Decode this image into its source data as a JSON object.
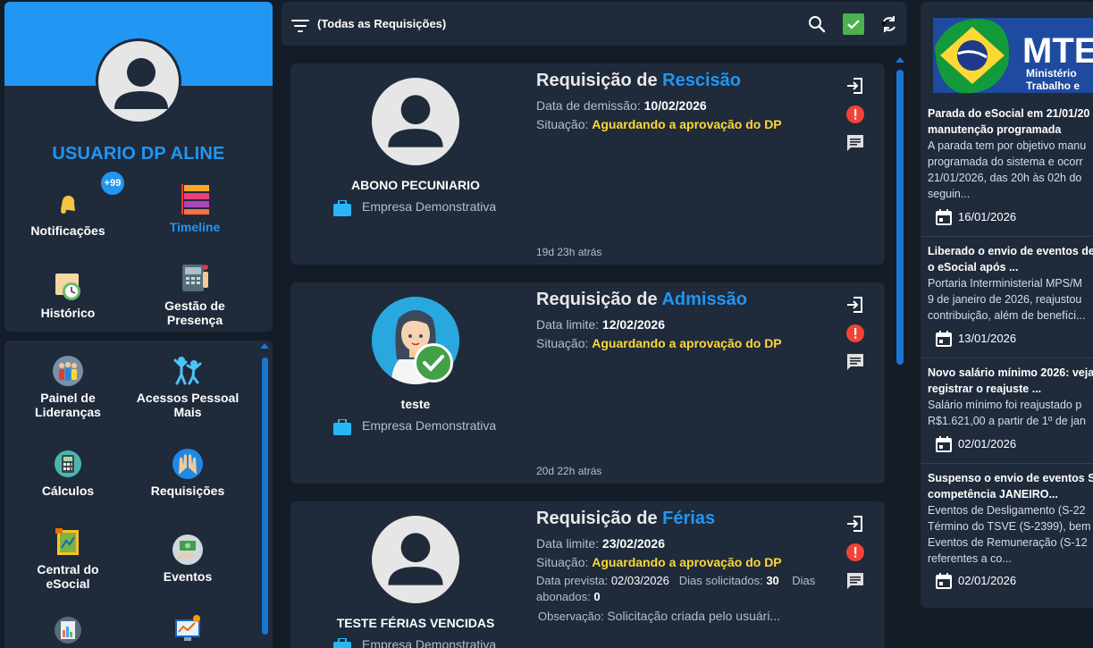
{
  "profile": {
    "user_name": "USUARIO DP ALINE",
    "notifications_badge": "+99",
    "items": [
      {
        "label": "Notificações"
      },
      {
        "label": "Timeline"
      },
      {
        "label": "Histórico"
      },
      {
        "label": "Gestão de Presença"
      }
    ]
  },
  "menu": {
    "items": [
      {
        "label": "Painel de Lideranças"
      },
      {
        "label": "Acessos Pessoal Mais"
      },
      {
        "label": "Cálculos"
      },
      {
        "label": "Requisições"
      },
      {
        "label": "Central do eSocial"
      },
      {
        "label": "Eventos"
      }
    ]
  },
  "toolbar": {
    "filter_label": "(Todas as Requisições)",
    "icons": [
      "filter-icon",
      "search-icon",
      "check-icon",
      "refresh-icon"
    ]
  },
  "requests": [
    {
      "title_prefix": "Requisição de",
      "kind": "Rescisão",
      "name": "ABONO PECUNIARIO",
      "company": "Empresa Demonstrativa",
      "date_label": "Data de demissão:",
      "date_value": "10/02/2026",
      "status_label": "Situação:",
      "status_value": "Aguardando a aprovação do DP",
      "time_ago": "19d 23h atrás"
    },
    {
      "title_prefix": "Requisição de",
      "kind": "Admissão",
      "name": "teste",
      "company": "Empresa Demonstrativa",
      "date_label": "Data limite:",
      "date_value": "12/02/2026",
      "status_label": "Situação:",
      "status_value": "Aguardando a aprovação do DP",
      "time_ago": "20d 22h atrás"
    },
    {
      "title_prefix": "Requisição de",
      "kind": "Férias",
      "name": "TESTE FÉRIAS VENCIDAS",
      "company": "Empresa Demonstrativa",
      "date_label": "Data limite:",
      "date_value": "23/02/2026",
      "status_label": "Situação:",
      "status_value": "Aguardando a aprovação do DP",
      "expected_label": "Data prevista:",
      "expected_value": "02/03/2026",
      "days_requested_label": "Dias solicitados:",
      "days_requested_value": "30",
      "days_bonus_label": "Dias",
      "days_bonus_label2": "abonados:",
      "days_bonus_value": "0",
      "note_label": "Observação:",
      "note_value": "Solicitação criada pelo usuári..."
    }
  ],
  "news": {
    "logo_text": "MTE",
    "logo_sub1": "Ministério",
    "logo_sub2": "Trabalho e",
    "items": [
      {
        "title1": "Parada do eSocial em 21/01/20",
        "title2": "manutenção programada",
        "body": [
          "A parada tem por objetivo manu",
          "programada do sistema e ocorr",
          "21/01/2026, das 20h às 02h do",
          "seguin..."
        ],
        "date": "16/01/2026"
      },
      {
        "title1": "Liberado o envio de eventos de",
        "title2": "o eSocial após ...",
        "body": [
          "Portaria Interministerial MPS/M",
          "9 de janeiro de 2026, reajustou",
          "contribuição, além de benefíci..."
        ],
        "date": "13/01/2026"
      },
      {
        "title1": "Novo salário mínimo 2026: veja",
        "title2": "registrar o reajuste ...",
        "body": [
          "Salário mínimo foi reajustado p",
          "R$1.621,00 a partir de 1º de jan"
        ],
        "date": "02/01/2026"
      },
      {
        "title1": "Suspenso o envio de eventos S",
        "title2": "competência JANEIRO...",
        "body": [
          "Eventos de Desligamento (S-22",
          "Término do TSVE (S-2399), bem",
          "Eventos de Remuneração (S-12",
          "referentes a co..."
        ],
        "date": "02/01/2026"
      }
    ]
  },
  "colors": {
    "accent": "#2196f3",
    "status": "#fdd835",
    "alert": "#f44336",
    "success": "#4caf50",
    "card": "#1f2a3a",
    "background": "#141c27"
  }
}
